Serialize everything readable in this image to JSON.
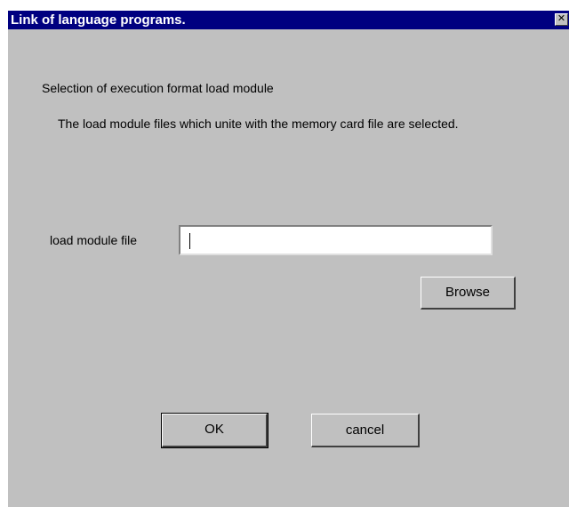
{
  "window": {
    "title": "Link of language programs.",
    "close_glyph": "✕"
  },
  "content": {
    "heading": "Selection of execution format load module",
    "description": "The load module files which unite with the memory card file are selected."
  },
  "form": {
    "load_module_label": "load module file",
    "load_module_value": ""
  },
  "buttons": {
    "browse": "Browse",
    "ok": "OK",
    "cancel": "cancel"
  }
}
